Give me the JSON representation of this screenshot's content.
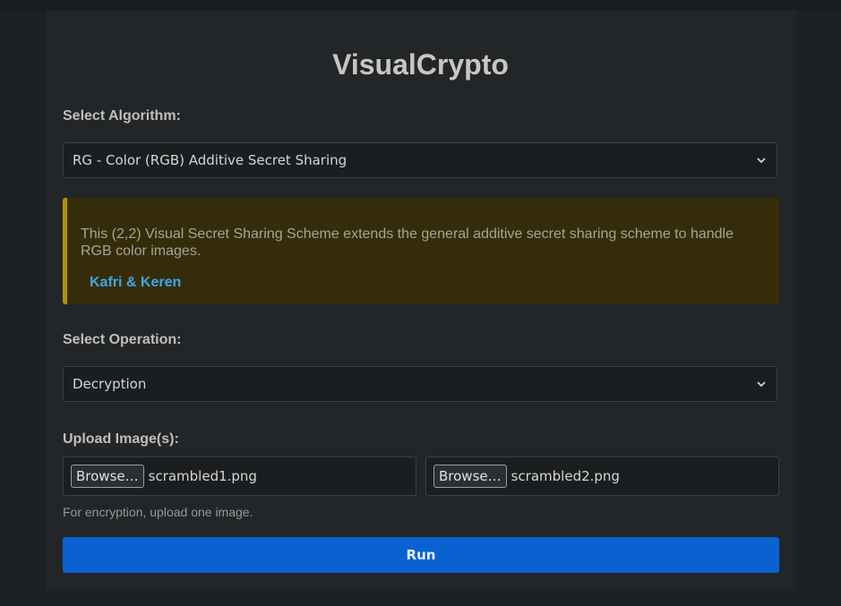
{
  "app": {
    "title": "VisualCrypto"
  },
  "algorithm": {
    "label": "Select Algorithm:",
    "selected": "RG - Color (RGB) Additive Secret Sharing"
  },
  "info": {
    "description": "This (2,2) Visual Secret Sharing Scheme extends the general additive secret sharing scheme to handle RGB color images.",
    "link_text": "Kafri & Keren"
  },
  "operation": {
    "label": "Select Operation:",
    "selected": "Decryption"
  },
  "upload": {
    "label": "Upload Image(s):",
    "files": [
      {
        "button_label": "Browse…",
        "file_name": "scrambled1.png"
      },
      {
        "button_label": "Browse…",
        "file_name": "scrambled2.png"
      }
    ],
    "hint": "For encryption, upload one image."
  },
  "run_button": {
    "label": "Run"
  },
  "icons": {
    "select_arrow": "chevron-down-icon"
  },
  "colors": {
    "accent": "#0a62d0",
    "link": "#3ea7ec",
    "warning_border": "#b38e0c",
    "warning_background": "#352d09",
    "background": "#1d2125",
    "card": "#222629"
  }
}
